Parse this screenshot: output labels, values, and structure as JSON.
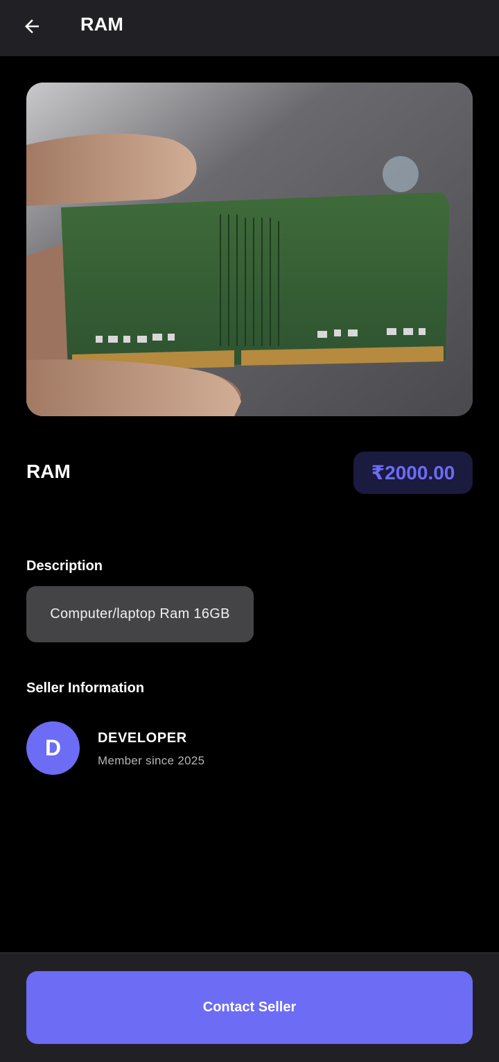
{
  "app_bar": {
    "title": "RAM",
    "back_icon": "arrow-left-icon"
  },
  "product": {
    "image_alt": "RAM module held in fingers",
    "name": "RAM",
    "price": "₹2000.00"
  },
  "description": {
    "heading": "Description",
    "text": "Computer/laptop Ram 16GB"
  },
  "seller": {
    "heading": "Seller Information",
    "avatar_initial": "D",
    "name": "DEVELOPER",
    "member_since": "Member since 2025"
  },
  "actions": {
    "contact_label": "Contact Seller"
  },
  "colors": {
    "accent": "#6c6cf5",
    "price_badge_bg": "#1b1a3f",
    "app_bar_bg": "#212125",
    "description_bg": "#444446"
  }
}
